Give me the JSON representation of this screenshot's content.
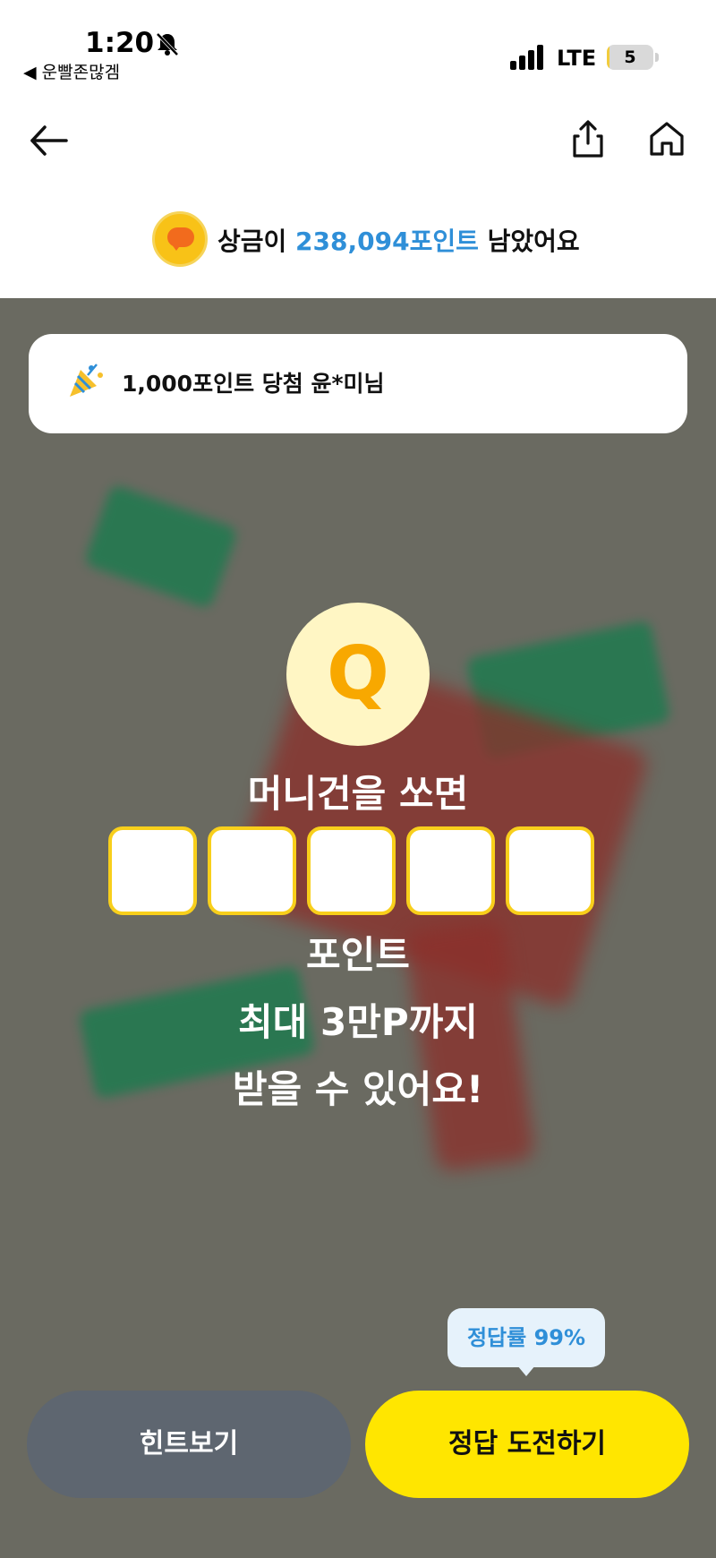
{
  "status_bar": {
    "time": "1:20",
    "back_app": "◀ 운빨존많겜",
    "network": "LTE",
    "battery": "5",
    "battery_level": 0.05,
    "icons": [
      "bell-off-icon",
      "signal-icon",
      "battery-icon"
    ]
  },
  "nav": {
    "icons": [
      "back-arrow-icon",
      "share-icon",
      "home-icon"
    ]
  },
  "prize": {
    "prefix": "상금이 ",
    "amount": "238,094포인트",
    "suffix": " 남았어요",
    "icon": "chat-bubble-coin-icon"
  },
  "winner": {
    "text": "1,000포인트 당첨 윤*미님",
    "icon": "party-popper-icon"
  },
  "quiz": {
    "badge": "Q",
    "line1": "머니건을 쏘면",
    "answer_box_count": 5,
    "line2": "포인트",
    "line3": "최대 3만P까지",
    "line4": "받을 수 있어요!"
  },
  "tooltip": {
    "text": "정답률 99%"
  },
  "buttons": {
    "hint": "힌트보기",
    "answer": "정답 도전하기"
  },
  "colors": {
    "accent_blue": "#2f8fd8",
    "primary_yellow": "#ffe600",
    "background_overlay": "#6a6a61",
    "hint_button": "#5e6670",
    "answer_box_border": "#f8cf1b"
  }
}
